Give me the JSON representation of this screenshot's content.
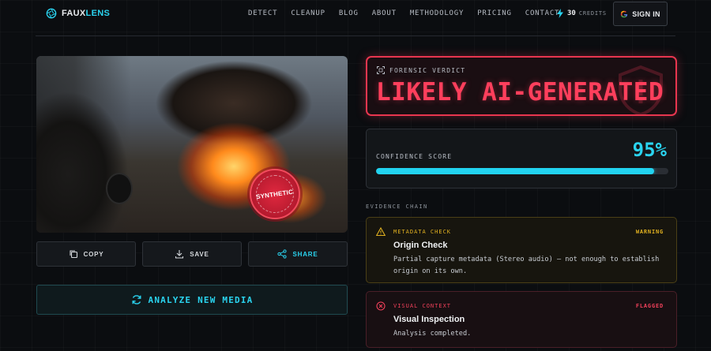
{
  "brand": {
    "name_a": "FAUX",
    "name_b": "LENS",
    "accent": "#2ad4f0"
  },
  "nav": {
    "links": [
      "DETECT",
      "CLEANUP",
      "BLOG",
      "ABOUT",
      "METHODOLOGY",
      "PRICING",
      "CONTACT"
    ],
    "credits_value": "30",
    "credits_label": "CREDITS",
    "signin_label": "SIGN IN"
  },
  "media": {
    "stamp_text": "SYNTHETIC",
    "icons": {
      "stamp": "ai-seal-stamp"
    }
  },
  "actions": {
    "copy": "COPY",
    "save": "SAVE",
    "share": "SHARE",
    "analyze": "ANALYZE NEW MEDIA"
  },
  "verdict": {
    "label": "FORENSIC VERDICT",
    "value": "LIKELY AI-GENERATED",
    "color": "#ff3f5c"
  },
  "confidence": {
    "label": "CONFIDENCE SCORE",
    "value_text": "95%",
    "percent": 95
  },
  "evidence": {
    "section_label": "EVIDENCE CHAIN",
    "items": [
      {
        "category": "METADATA CHECK",
        "status": "WARNING",
        "title": "Origin Check",
        "description": "Partial capture metadata (Stereo audio) — not enough to establish origin on its own.",
        "color": "#e0b020"
      },
      {
        "category": "VISUAL CONTEXT",
        "status": "FLAGGED",
        "title": "Visual Inspection",
        "description": "Analysis completed.",
        "color": "#f0405a"
      }
    ]
  }
}
